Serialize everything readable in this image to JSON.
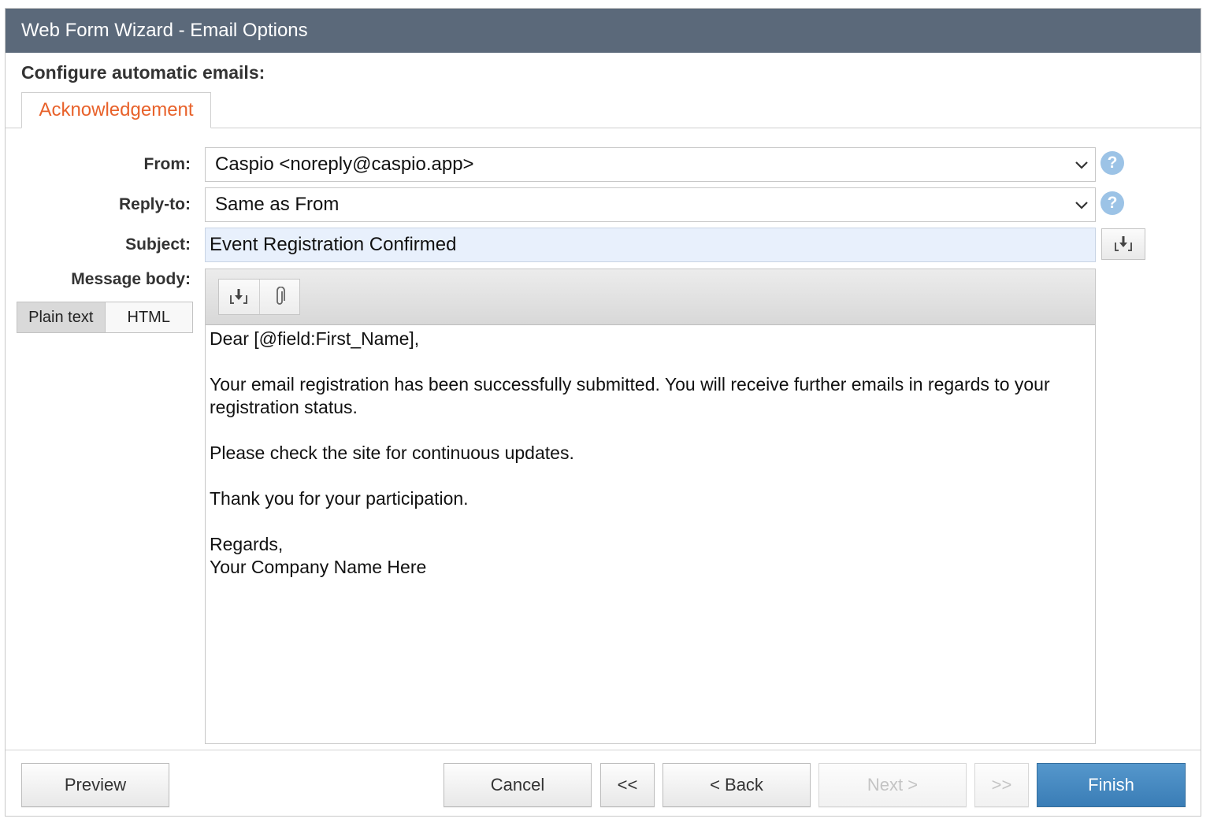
{
  "window": {
    "title": "Web Form Wizard - Email Options"
  },
  "section": {
    "heading": "Configure automatic emails:"
  },
  "tabs": [
    {
      "label": "Acknowledgement",
      "active": true
    }
  ],
  "fields": {
    "from": {
      "label": "From:",
      "value": "Caspio <noreply@caspio.app>"
    },
    "reply_to": {
      "label": "Reply-to:",
      "value": "Same as From"
    },
    "subject": {
      "label": "Subject:",
      "value": "Event Registration Confirmed"
    },
    "message_body": {
      "label": "Message body:"
    }
  },
  "body_format": {
    "plain_text": "Plain text",
    "html": "HTML",
    "selected": "Plain text"
  },
  "message_lines": {
    "greeting": "Dear [@field:First_Name],",
    "line1": "Your email registration has been successfully submitted. You will receive further emails in regards to your registration status.",
    "line2": "Please check the site for continuous updates.",
    "line3": "Thank you for your participation.",
    "closing": "Regards,",
    "signature": "Your Company Name Here"
  },
  "footer": {
    "preview": "Preview",
    "cancel": "Cancel",
    "first": "<<",
    "back": "< Back",
    "next": "Next >",
    "last": ">>",
    "finish": "Finish"
  },
  "colors": {
    "titlebar": "#5b697a",
    "tab_text": "#e8622b",
    "help_icon": "#9cc3e6",
    "subject_bg": "#e8f0fc",
    "finish_button": "#3a7db6"
  },
  "icons": {
    "help": "help-question-icon",
    "insert_field": "insert-field-icon",
    "attachment": "paperclip-icon",
    "dropdown": "chevron-down-icon"
  }
}
